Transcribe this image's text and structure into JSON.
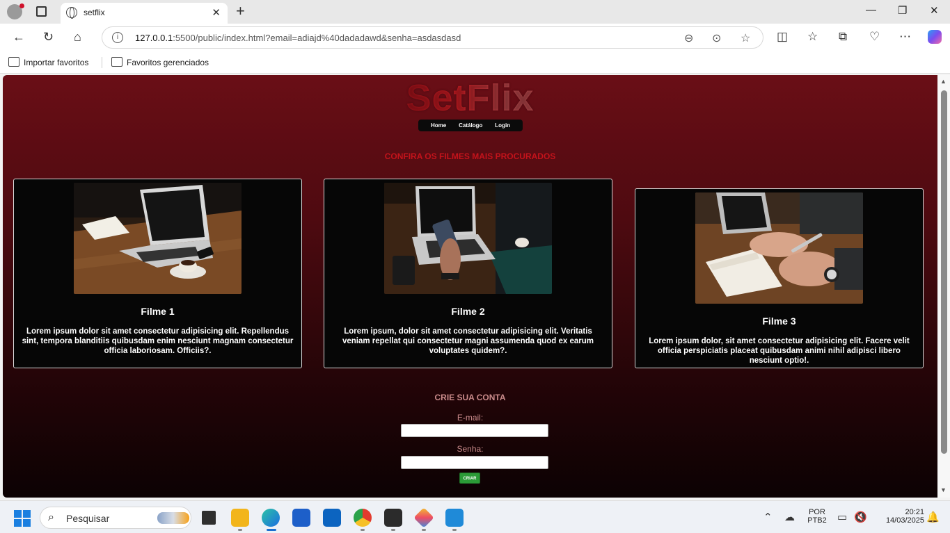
{
  "browser": {
    "tab_title": "setflix",
    "url_host": "127.0.0.1",
    "url_rest": ":5500/public/index.html?email=adiajd%40dadadawd&senha=asdasdasd",
    "favorites": [
      "Importar favoritos",
      "Favoritos gerenciados"
    ]
  },
  "site": {
    "logo": "SetFlix",
    "nav": [
      "Home",
      "Catálogo",
      "Login"
    ],
    "section_title": "CONFIRA OS FILMES MAIS PROCURADOS",
    "movies": [
      {
        "title": "Filme 1",
        "desc": "Lorem ipsum dolor sit amet consectetur adipisicing elit. Repellendus sint, tempora blanditiis quibusdam enim nesciunt magnam consectetur officia laboriosam. Officiis?."
      },
      {
        "title": "Filme 2",
        "desc": "Lorem ipsum, dolor sit amet consectetur adipisicing elit. Veritatis veniam repellat qui consectetur magni assumenda quod ex earum voluptates quidem?."
      },
      {
        "title": "Filme 3",
        "desc": "Lorem ipsum dolor, sit amet consectetur adipisicing elit. Facere velit officia perspiciatis placeat quibusdam animi nihil adipisci libero nesciunt optio!."
      }
    ],
    "signup": {
      "title": "CRIE SUA CONTA",
      "email_label": "E-mail:",
      "password_label": "Senha:",
      "button": "CRIAR"
    }
  },
  "taskbar": {
    "search_placeholder": "Pesquisar",
    "lang_top": "POR",
    "lang_bottom": "PTB2",
    "time": "20:21",
    "date": "14/03/2025"
  },
  "colors": {
    "brand_red": "#c3131b",
    "card_bg": "#060606",
    "button_green": "#2b9a37"
  }
}
